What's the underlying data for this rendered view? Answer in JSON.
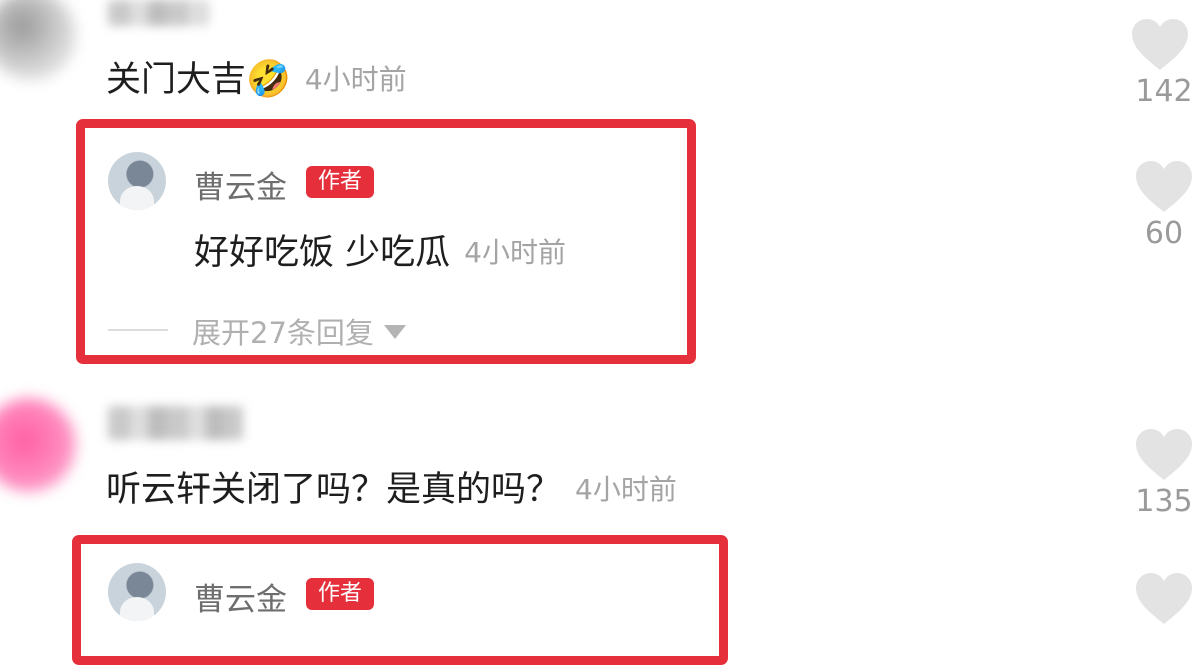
{
  "comments": [
    {
      "text": "关门大吉",
      "emoji": "🤣",
      "time": "4小时前",
      "likes": "142",
      "reply": {
        "author": "曹云金",
        "badge": "作者",
        "text": "好好吃饭 少吃瓜",
        "time": "4小时前",
        "likes": "60",
        "expand_label": "展开27条回复"
      }
    },
    {
      "text": "听云轩关闭了吗？是真的吗？",
      "time": "4小时前",
      "likes": "135",
      "reply": {
        "author": "曹云金",
        "badge": "作者"
      }
    }
  ],
  "colors": {
    "highlight_red": "#e5303c",
    "badge_red": "#e5303c",
    "muted_text": "#a4a4a4",
    "heart_gray": "#e3e3e3"
  },
  "icons": {
    "like": "heart-icon",
    "expand": "triangle-down-icon"
  }
}
